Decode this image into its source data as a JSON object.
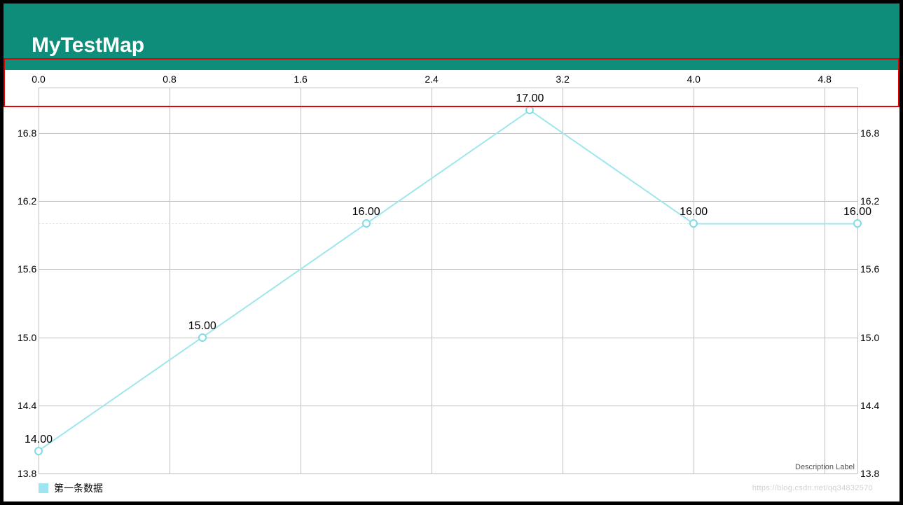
{
  "app": {
    "title": "MyTestMap"
  },
  "chart_data": {
    "type": "line",
    "x": [
      0,
      1,
      2,
      3,
      4,
      5
    ],
    "values": [
      14.0,
      15.0,
      16.0,
      17.0,
      16.0,
      16.0
    ],
    "value_labels": [
      "14.00",
      "15.00",
      "16.00",
      "17.00",
      "16.00",
      "16.00"
    ],
    "series_name": "第一条数据",
    "x_ticks": [
      "0.0",
      "0.8",
      "1.6",
      "2.4",
      "3.2",
      "4.0",
      "4.8"
    ],
    "y_ticks_left": [
      "13.8",
      "14.4",
      "15.0",
      "15.6",
      "16.2",
      "16.8"
    ],
    "y_ticks_right": [
      "13.8",
      "14.4",
      "15.0",
      "15.6",
      "16.2",
      "16.8"
    ],
    "ylim": [
      13.8,
      17.2
    ],
    "xlim": [
      0.0,
      5.0
    ],
    "limit_line_value": 16.0,
    "description": "Description Label",
    "line_color": "#9fe5ef"
  },
  "legend": {
    "label": "第一条数据"
  },
  "watermark": "https://blog.csdn.net/qq34832570"
}
